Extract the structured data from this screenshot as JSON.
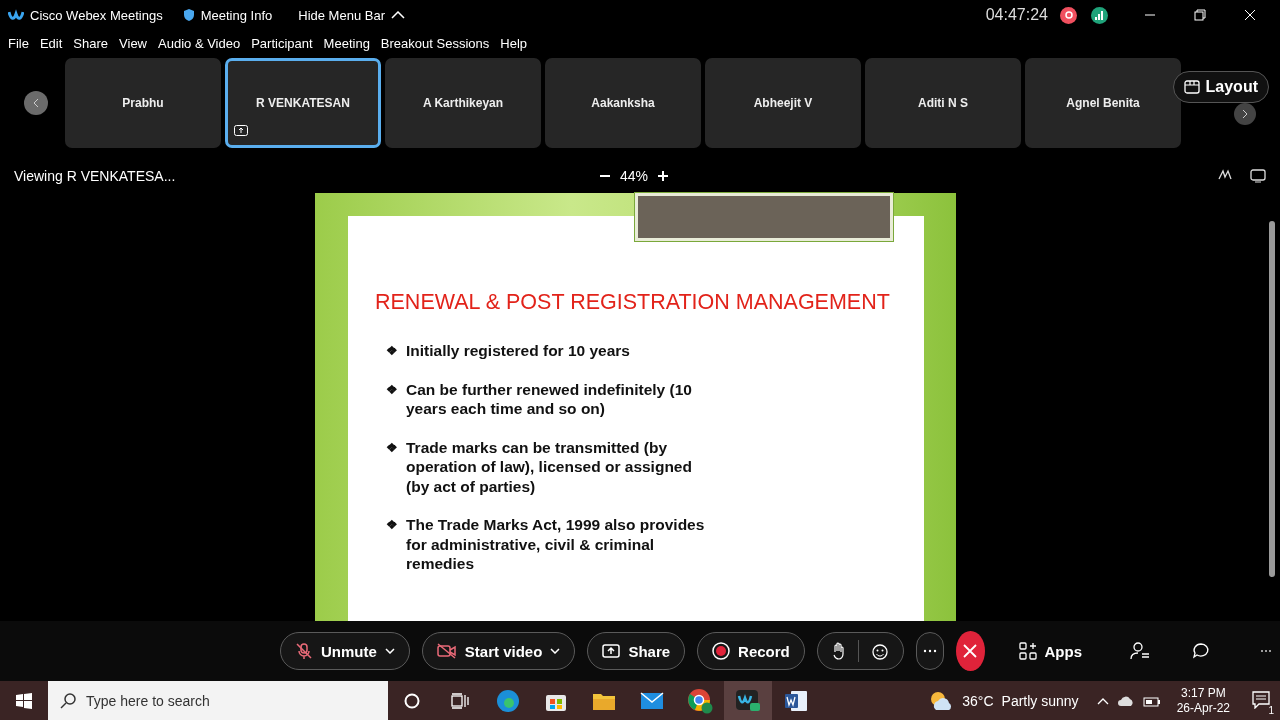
{
  "title_bar": {
    "app_name": "Cisco Webex Meetings",
    "meeting_info": "Meeting Info",
    "hide_menu_bar": "Hide Menu Bar",
    "timer": "04:47:24"
  },
  "menu": [
    "File",
    "Edit",
    "Share",
    "View",
    "Audio & Video",
    "Participant",
    "Meeting",
    "Breakout Sessions",
    "Help"
  ],
  "participants": [
    {
      "name": "Prabhu",
      "selected": false,
      "sharing": false
    },
    {
      "name": "R VENKATESAN",
      "selected": true,
      "sharing": true
    },
    {
      "name": "A Karthikeyan",
      "selected": false,
      "sharing": false
    },
    {
      "name": "Aakanksha",
      "selected": false,
      "sharing": false
    },
    {
      "name": "Abheejit V",
      "selected": false,
      "sharing": false
    },
    {
      "name": "Aditi N S",
      "selected": false,
      "sharing": false
    },
    {
      "name": "Agnel Benita",
      "selected": false,
      "sharing": false
    }
  ],
  "layout_button": "Layout",
  "view_bar": {
    "viewing": "Viewing R VENKATESA...",
    "zoom": "44%"
  },
  "slide": {
    "title": "RENEWAL & POST REGISTRATION MANAGEMENT",
    "bullets": [
      {
        "marker": "❖",
        "text": "Initially registered for 10 years"
      },
      {
        "marker": "❖",
        "text": "Can be further renewed indefinitely (10 years each time and so on)"
      },
      {
        "marker": "❖",
        "text": "Trade marks can be transmitted (by operation of law), licensed or assigned (by act of parties)"
      },
      {
        "marker": "❖",
        "text": "The Trade Marks Act, 1999 also provides for administrative, civil & criminal remedies"
      }
    ]
  },
  "toolbar": [
    {
      "kind": "mic",
      "label": "Unmute"
    },
    {
      "kind": "video",
      "label": "Start video"
    },
    {
      "kind": "share",
      "label": "Share"
    },
    {
      "kind": "record",
      "label": "Record"
    }
  ],
  "apps_button": "Apps",
  "taskbar": {
    "search_placeholder": "Type here to search",
    "temperature": "36°C",
    "weather": "Partly sunny",
    "time": "3:17 PM",
    "date": "26-Apr-22",
    "notifications": "1"
  }
}
